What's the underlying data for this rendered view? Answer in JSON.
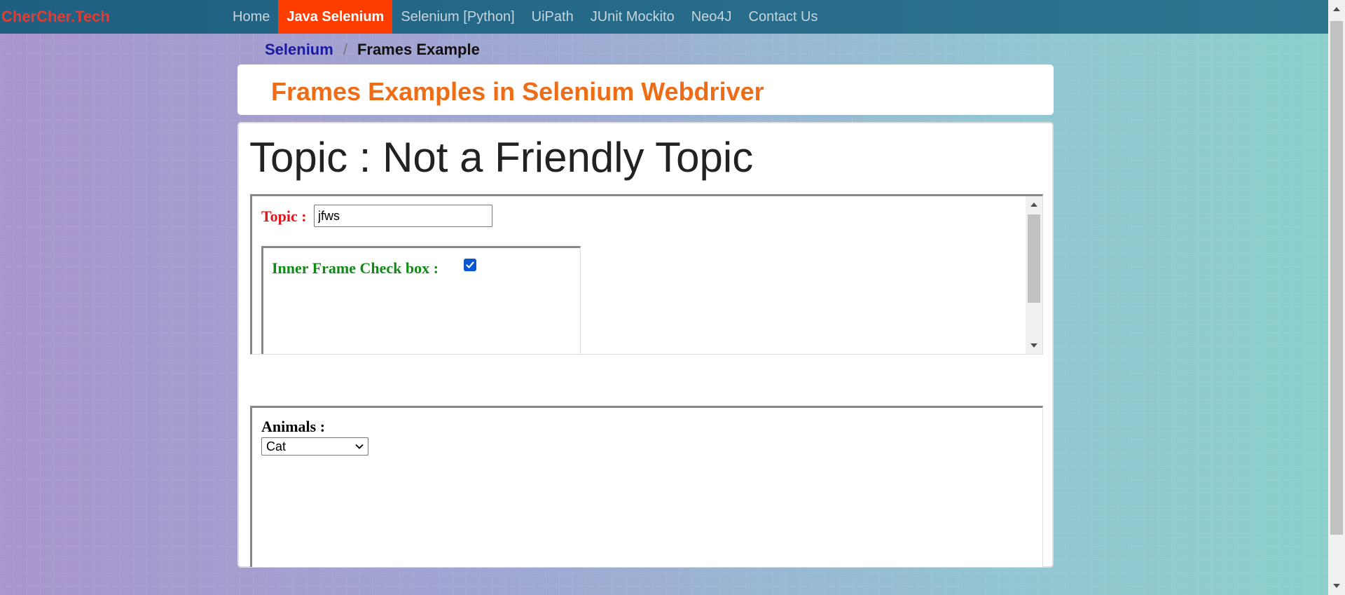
{
  "navbar": {
    "brand": "CherCher.Tech",
    "items": [
      {
        "label": "Home",
        "active": false
      },
      {
        "label": "Java Selenium",
        "active": true
      },
      {
        "label": "Selenium [Python]",
        "active": false
      },
      {
        "label": "UiPath",
        "active": false
      },
      {
        "label": "JUnit Mockito",
        "active": false
      },
      {
        "label": "Neo4J",
        "active": false
      },
      {
        "label": "Contact Us",
        "active": false
      }
    ]
  },
  "breadcrumb": {
    "link": "Selenium",
    "separator": "/",
    "current": "Frames Example"
  },
  "page_title": "Frames Examples in Selenium Webdriver",
  "main": {
    "topic_heading": "Topic : Not a Friendly Topic",
    "frame1": {
      "topic_label": "Topic :",
      "topic_value": "jfws",
      "inner_frame": {
        "checkbox_label": "Inner Frame Check box :",
        "checked": true
      }
    },
    "frame2": {
      "animals_label": "Animals :",
      "animals_selected": "Cat"
    }
  },
  "colors": {
    "brand": "#e83a2f",
    "nav_active": "#ff3d00",
    "title": "#ef6c16",
    "topic_label": "#e4151b",
    "inner_label": "#0f8a16"
  }
}
